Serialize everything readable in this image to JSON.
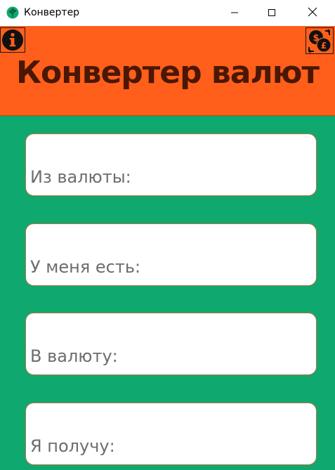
{
  "window": {
    "title": "Конвертер",
    "icon": "tree-app-icon"
  },
  "controls": {
    "minimize": "minimize-icon",
    "maximize": "maximize-icon",
    "close": "close-icon"
  },
  "header": {
    "title": "Конвертер валют",
    "info_icon": "info-icon",
    "swap_icon": "currency-exchange-icon",
    "background_color": "#ff5f1b",
    "title_color": "#4a1705"
  },
  "form": {
    "background_color": "#0fa86f",
    "fields": [
      {
        "placeholder": "Из валюты:"
      },
      {
        "placeholder": "У меня есть:"
      },
      {
        "placeholder": "В валюту:"
      },
      {
        "placeholder": "Я получу:"
      }
    ]
  }
}
